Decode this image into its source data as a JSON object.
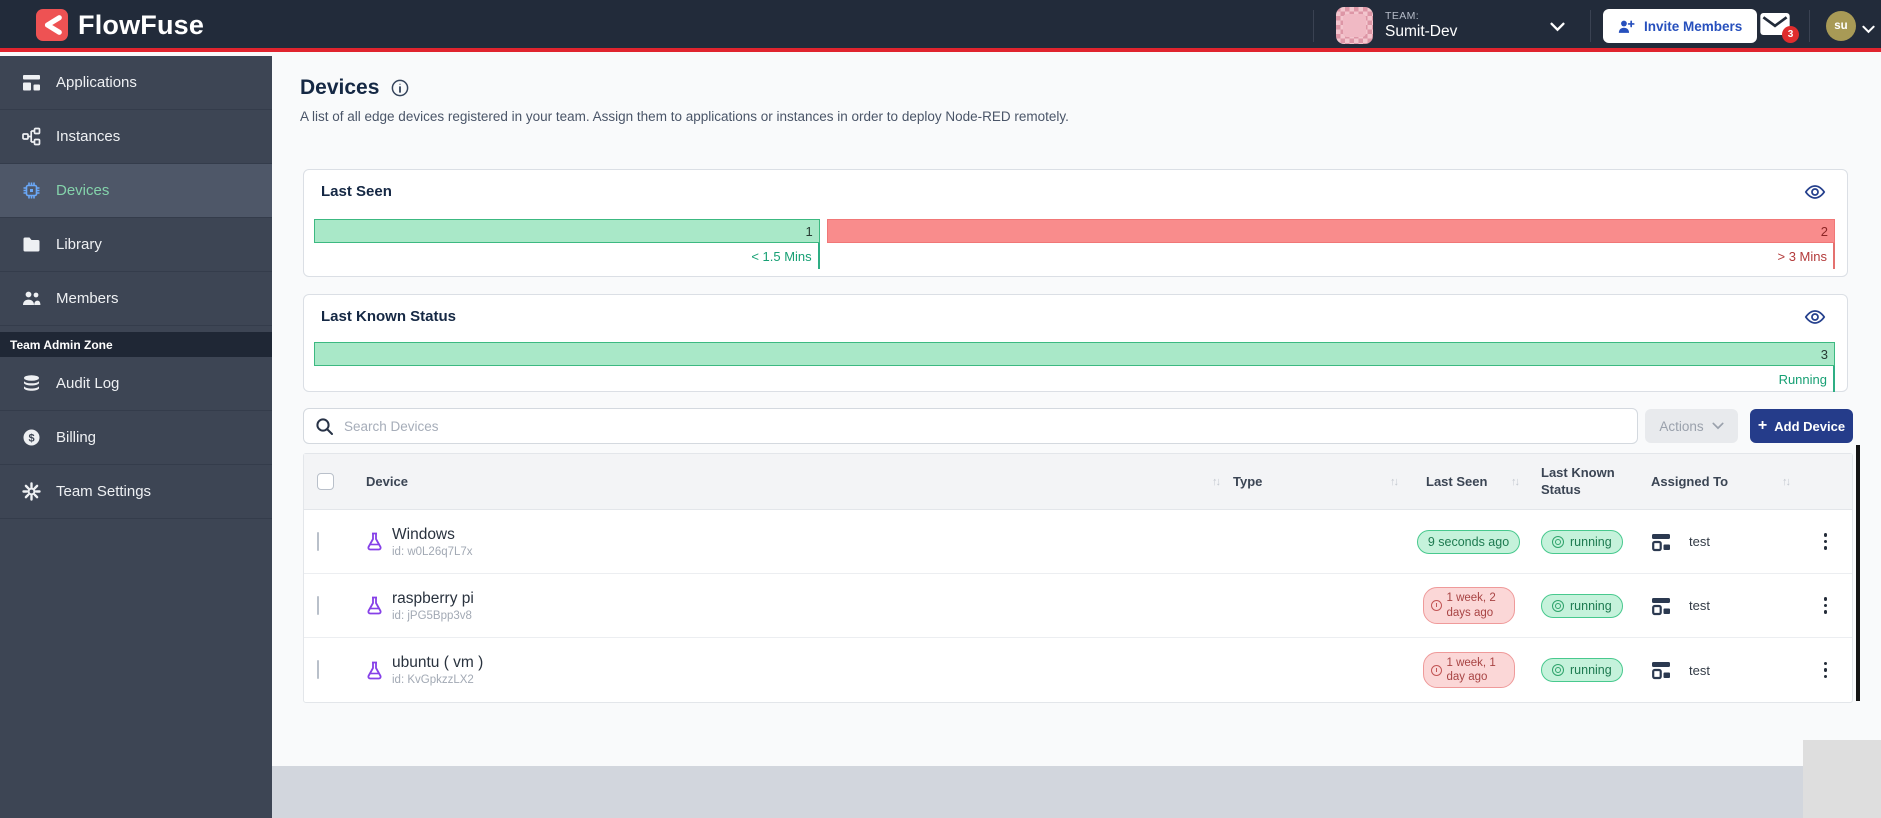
{
  "header": {
    "brand": "FlowFuse",
    "team_label": "TEAM:",
    "team_name": "Sumit-Dev",
    "invite_label": "Invite Members",
    "mail_badge": "3",
    "avatar_initials": "su"
  },
  "sidebar": {
    "items": [
      {
        "label": "Applications",
        "icon": "applications-icon"
      },
      {
        "label": "Instances",
        "icon": "instances-icon"
      },
      {
        "label": "Devices",
        "icon": "chip-icon",
        "active": true
      },
      {
        "label": "Library",
        "icon": "folder-icon"
      },
      {
        "label": "Members",
        "icon": "users-icon"
      }
    ],
    "admin_zone_label": "Team Admin Zone",
    "admin_items": [
      {
        "label": "Audit Log",
        "icon": "database-icon"
      },
      {
        "label": "Billing",
        "icon": "dollar-icon"
      },
      {
        "label": "Team Settings",
        "icon": "gear-icon"
      }
    ]
  },
  "page": {
    "title": "Devices",
    "description": "A list of all edge devices registered in your team. Assign them to applications or instances in order to deploy Node-RED remotely."
  },
  "panels": {
    "last_seen": {
      "title": "Last Seen",
      "segments": [
        {
          "value": "1",
          "label": "< 1.5 Mins",
          "color": "#a9e8c8",
          "width_pct": 33.4
        },
        {
          "value": "2",
          "label": "> 3 Mins",
          "color": "#f98c8c",
          "width_pct": 66.6
        }
      ]
    },
    "last_known_status": {
      "title": "Last Known Status",
      "segments": [
        {
          "value": "3",
          "label": "Running",
          "color": "#a9e8c8",
          "width_pct": 100
        }
      ]
    }
  },
  "toolbar": {
    "search_placeholder": "Search Devices",
    "actions_label": "Actions",
    "add_device_label": "Add Device"
  },
  "table": {
    "header": {
      "device": "Device",
      "type": "Type",
      "last_seen": "Last Seen",
      "last_known_status": "Last Known Status",
      "assigned_to": "Assigned To"
    },
    "rows": [
      {
        "name": "Windows",
        "id": "id: w0L26q7L7x",
        "last_seen": "9 seconds ago",
        "last_seen_state": "recent",
        "status": "running",
        "assigned_to": "test"
      },
      {
        "name": "raspberry pi",
        "id": "id: jPG5Bpp3v8",
        "last_seen": "1 week, 2 days ago",
        "last_seen_state": "stale",
        "status": "running",
        "assigned_to": "test"
      },
      {
        "name": "ubuntu ( vm )",
        "id": "id: KvGpkzzLX2",
        "last_seen": "1 week, 1 day ago",
        "last_seen_state": "stale",
        "status": "running",
        "assigned_to": "test"
      }
    ]
  },
  "colors": {
    "topbar": "#222b3a",
    "accent_red": "#e0242e",
    "sidebar": "#3d4554",
    "primary_button": "#253c8a",
    "green_bar": "#a9e8c8",
    "red_bar": "#f98c8c"
  }
}
